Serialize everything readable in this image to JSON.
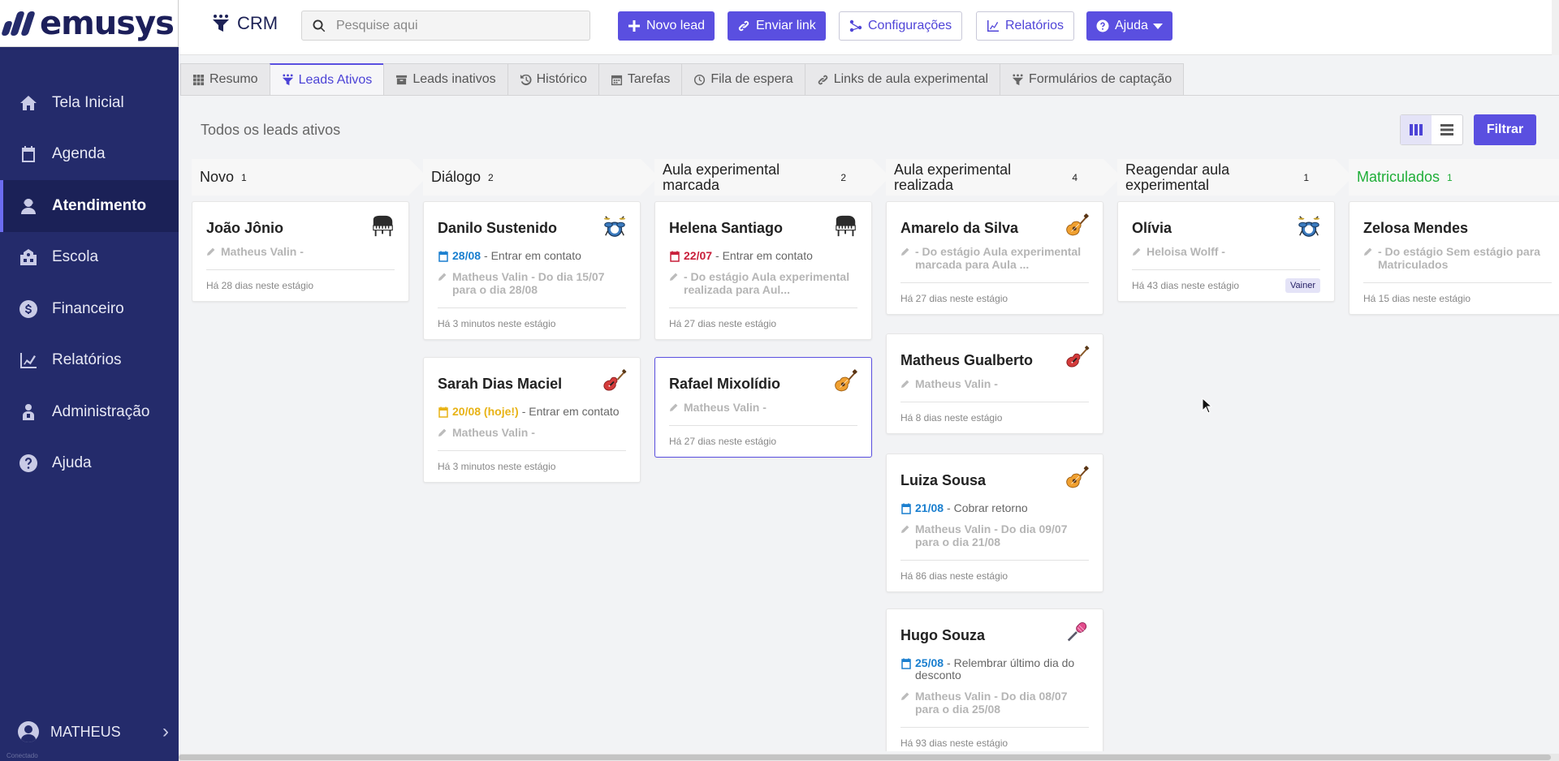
{
  "app": {
    "logo_text": "emusys",
    "module": "CRM"
  },
  "sidebar": {
    "items": [
      {
        "label": "Tela Inicial",
        "icon": "home-icon"
      },
      {
        "label": "Agenda",
        "icon": "calendar-icon"
      },
      {
        "label": "Atendimento",
        "icon": "headset-icon",
        "active": true
      },
      {
        "label": "Escola",
        "icon": "school-icon"
      },
      {
        "label": "Financeiro",
        "icon": "dollar-icon"
      },
      {
        "label": "Relatórios",
        "icon": "chart-icon"
      },
      {
        "label": "Administração",
        "icon": "admin-icon"
      },
      {
        "label": "Ajuda",
        "icon": "help-icon"
      }
    ],
    "user": "MATHEUS",
    "status": "Conectado"
  },
  "header": {
    "search_placeholder": "Pesquise aqui",
    "buttons": {
      "new_lead": "Novo lead",
      "send_link": "Enviar link",
      "settings": "Configurações",
      "reports": "Relatórios",
      "help": "Ajuda"
    }
  },
  "tabs": [
    {
      "label": "Resumo",
      "icon": "grid-icon"
    },
    {
      "label": "Leads Ativos",
      "icon": "funnel-icon",
      "active": true
    },
    {
      "label": "Leads inativos",
      "icon": "archive-icon"
    },
    {
      "label": "Histórico",
      "icon": "history-icon"
    },
    {
      "label": "Tarefas",
      "icon": "calendar-icon"
    },
    {
      "label": "Fila de espera",
      "icon": "clock-icon"
    },
    {
      "label": "Links de aula experimental",
      "icon": "link-icon"
    },
    {
      "label": "Formulários de captação",
      "icon": "funnel-icon"
    }
  ],
  "board": {
    "subtitle": "Todos os leads ativos",
    "filter_label": "Filtrar",
    "columns": [
      {
        "title": "Novo",
        "count": "1",
        "cards": [
          {
            "name": "João Jônio",
            "instrument": "piano",
            "note": "Matheus Valin -",
            "since": "Há 28 dias neste estágio"
          }
        ]
      },
      {
        "title": "Diálogo",
        "count": "2",
        "cards": [
          {
            "name": "Danilo Sustenido",
            "instrument": "drums",
            "task_date": "28/08",
            "task_text": "- Entrar em contato",
            "note": "Matheus Valin - Do dia 15/07 para o dia 28/08",
            "since": "Há 3 minutos neste estágio"
          },
          {
            "name": "Sarah Dias Maciel",
            "instrument": "electric-guitar",
            "task_date": "20/08 (hoje!)",
            "task_text": "- Entrar em contato",
            "note": "Matheus Valin -",
            "since": "Há 3 minutos neste estágio"
          }
        ]
      },
      {
        "title": "Aula experimental marcada",
        "count": "2",
        "cards": [
          {
            "name": "Helena Santiago",
            "instrument": "piano",
            "task_date": "22/07",
            "task_text": "- Entrar em contato",
            "note": "- Do estágio Aula experimental realizada para Aul...",
            "since": "Há 27 dias neste estágio"
          },
          {
            "name": "Rafael Mixolídio",
            "instrument": "acoustic-guitar",
            "note": "Matheus Valin -",
            "since": "Há 27 dias neste estágio"
          }
        ]
      },
      {
        "title": "Aula experimental realizada",
        "count": "4",
        "cards": [
          {
            "name": "Amarelo da Silva",
            "instrument": "acoustic-guitar",
            "note": "- Do estágio Aula experimental marcada para Aula ...",
            "since": "Há 27 dias neste estágio"
          },
          {
            "name": "Matheus Gualberto",
            "instrument": "electric-guitar",
            "note": "Matheus Valin -",
            "since": "Há 8 dias neste estágio"
          },
          {
            "name": "Luiza Sousa",
            "instrument": "acoustic-guitar",
            "task_date": "21/08",
            "task_text": "- Cobrar retorno",
            "note": "Matheus Valin - Do dia 09/07 para o dia 21/08",
            "since": "Há 86 dias neste estágio"
          },
          {
            "name": "Hugo Souza",
            "instrument": "microphone",
            "task_date": "25/08",
            "task_text": "- Relembrar último dia do desconto",
            "note": "Matheus Valin - Do dia 08/07 para o dia 25/08",
            "since": "Há 93 dias neste estágio"
          }
        ]
      },
      {
        "title": "Reagendar aula experimental",
        "count": "1",
        "cards": [
          {
            "name": "Olívia",
            "instrument": "drums",
            "note": "Heloisa Wolff -",
            "since": "Há 43 dias neste estágio",
            "tag": "Vainer"
          }
        ]
      },
      {
        "title": "Matriculados",
        "count": "1",
        "cards": [
          {
            "name": "Zelosa Mendes",
            "note": "- Do estágio Sem estágio para Matriculados",
            "since": "Há 15 dias neste estágio"
          }
        ]
      }
    ]
  },
  "colors": {
    "sidebar": "#242b6b",
    "primary": "#5a4fe0",
    "due_date": "#1a7fcf",
    "overdue": "#c81e3a",
    "today": "#e8b316",
    "enrolled": "#1fae38"
  }
}
